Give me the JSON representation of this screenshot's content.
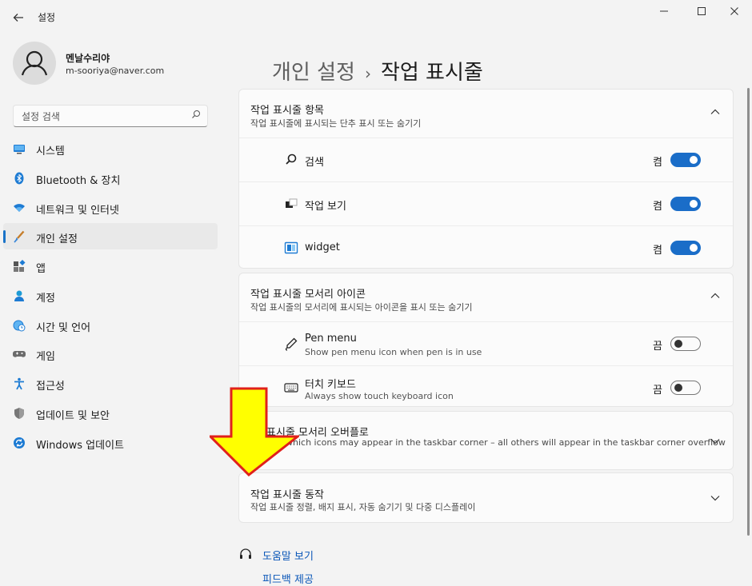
{
  "window": {
    "title": "설정",
    "controls": [
      "minimize-icon",
      "maximize-icon",
      "close-icon"
    ]
  },
  "profile": {
    "name": "멘날수리야",
    "email": "m-sooriya@naver.com"
  },
  "search": {
    "placeholder": "설정 검색"
  },
  "nav": {
    "items": [
      {
        "label": "시스템",
        "icon": "monitor-icon"
      },
      {
        "label": "Bluetooth & 장치",
        "icon": "bluetooth-icon"
      },
      {
        "label": "네트워크 및 인터넷",
        "icon": "wifi-icon"
      },
      {
        "label": "개인 설정",
        "icon": "brush-icon",
        "selected": true
      },
      {
        "label": "앱",
        "icon": "apps-icon"
      },
      {
        "label": "계정",
        "icon": "account-icon"
      },
      {
        "label": "시간 및 언어",
        "icon": "globe-clock-icon"
      },
      {
        "label": "게임",
        "icon": "gamepad-icon"
      },
      {
        "label": "접근성",
        "icon": "accessibility-icon"
      },
      {
        "label": "업데이트 및 보안",
        "icon": "shield-icon"
      },
      {
        "label": "Windows 업데이트",
        "icon": "update-icon"
      }
    ]
  },
  "breadcrumb": {
    "parent": "개인 설정",
    "separator": "›",
    "current": "작업 표시줄"
  },
  "cards": {
    "items": {
      "title": "작업 표시줄 항목",
      "desc": "작업 표시줄에 표시되는 단추 표시 또는 숨기기",
      "rows": [
        {
          "label": "검색",
          "state": "켬",
          "on": true
        },
        {
          "label": "작업 보기",
          "state": "켬",
          "on": true
        },
        {
          "label": "widget",
          "state": "켬",
          "on": true
        }
      ]
    },
    "corner_icons": {
      "title": "작업 표시줄 모서리 아이콘",
      "desc": "작업 표시줄의 모서리에 표시되는 아이콘을 표시 또는 숨기기",
      "rows": [
        {
          "label": "Pen menu",
          "sub": "Show pen menu icon when pen is in use",
          "state": "끔",
          "on": false
        },
        {
          "label": "터치 키보드",
          "sub": "Always show touch keyboard icon",
          "state": "끔",
          "on": false
        }
      ]
    },
    "overflow": {
      "title": "표시줄 모서리 오버플로",
      "desc": "which icons may appear in the taskbar corner – all others will appear in the taskbar corner overflow"
    },
    "behavior": {
      "title": "작업 표시줄 동작",
      "desc": "작업 표시줄 정렬, 배지 표시, 자동 숨기기 및 다중 디스플레이"
    }
  },
  "links": {
    "help": "도움말 보기",
    "feedback": "피드백 제공"
  },
  "annotation": {
    "shape": "arrow-down",
    "fill": "#ffff00",
    "stroke": "#e0201b"
  },
  "colors": {
    "accent": "#1a6dc8",
    "link": "#0b57b8",
    "background": "#f3f3f3"
  }
}
